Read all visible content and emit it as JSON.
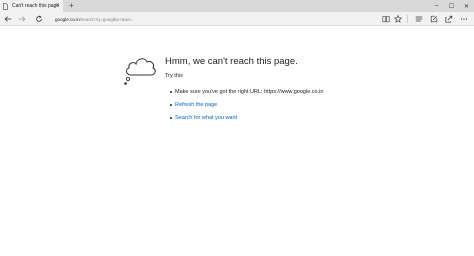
{
  "tab": {
    "title": "Can't reach this page",
    "close": "✕",
    "new_tab": "+"
  },
  "window_controls": {
    "minimize": "–",
    "maximize": "☐",
    "close": "✕"
  },
  "address_bar": {
    "host": "google.co.in",
    "path": "/search?q=googlba+&oe="
  },
  "error": {
    "heading": "Hmm, we can't reach this page.",
    "try_this": "Try this",
    "suggestions": [
      {
        "text": "Make sure you've got the right URL: https://www.google.co.in"
      }
    ],
    "links": [
      {
        "text": "Refresh the page"
      },
      {
        "text": "Search for what you want"
      }
    ]
  },
  "colors": {
    "link": "#0066cc",
    "tab_active": "#f2f2f2",
    "tabstrip": "#d9d9d9"
  },
  "icons": [
    "page-icon",
    "back-icon",
    "forward-icon",
    "refresh-icon",
    "reading-view-icon",
    "favorite-star-icon",
    "hub-icon",
    "web-note-icon",
    "share-icon",
    "more-icon",
    "sad-cloud-icon"
  ]
}
